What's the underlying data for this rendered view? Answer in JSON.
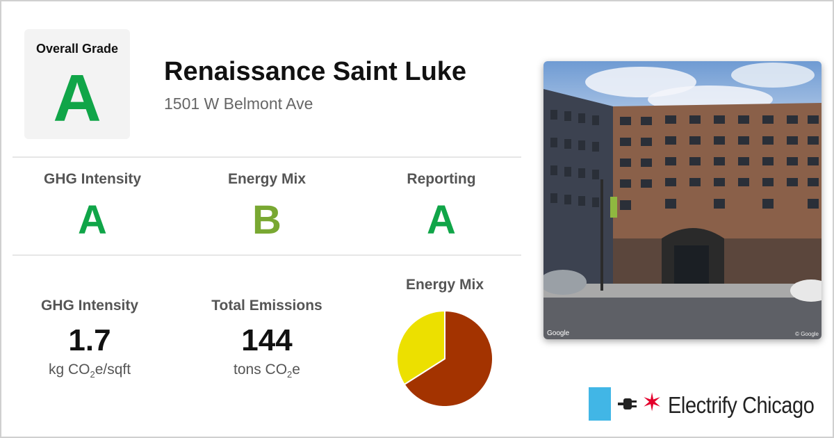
{
  "overall": {
    "label": "Overall Grade",
    "grade": "A"
  },
  "building": {
    "name": "Renaissance Saint Luke",
    "address": "1501 W Belmont Ave"
  },
  "grades": [
    {
      "title": "GHG Intensity",
      "grade": "A",
      "color": "#10a548"
    },
    {
      "title": "Energy Mix",
      "grade": "B",
      "color": "#79a832"
    },
    {
      "title": "Reporting",
      "grade": "A",
      "color": "#10a548"
    }
  ],
  "stats": {
    "ghg": {
      "title": "GHG Intensity",
      "value": "1.7",
      "unit_prefix": "kg CO",
      "unit_sub": "2",
      "unit_suffix": "e/sqft"
    },
    "emissions": {
      "title": "Total Emissions",
      "value": "144",
      "unit_prefix": "tons CO",
      "unit_sub": "2",
      "unit_suffix": "e"
    }
  },
  "energy_mix": {
    "title": "Energy Mix",
    "slices": [
      {
        "fraction": 0.66,
        "color": "#a33300"
      },
      {
        "fraction": 0.34,
        "color": "#ece000"
      }
    ]
  },
  "photo": {
    "credit_left": "Google",
    "credit_right": "© Google"
  },
  "brand": {
    "name": "Electrify Chicago",
    "star": "✶",
    "flag_color": "#41b6e6",
    "star_color": "#e4002b"
  }
}
